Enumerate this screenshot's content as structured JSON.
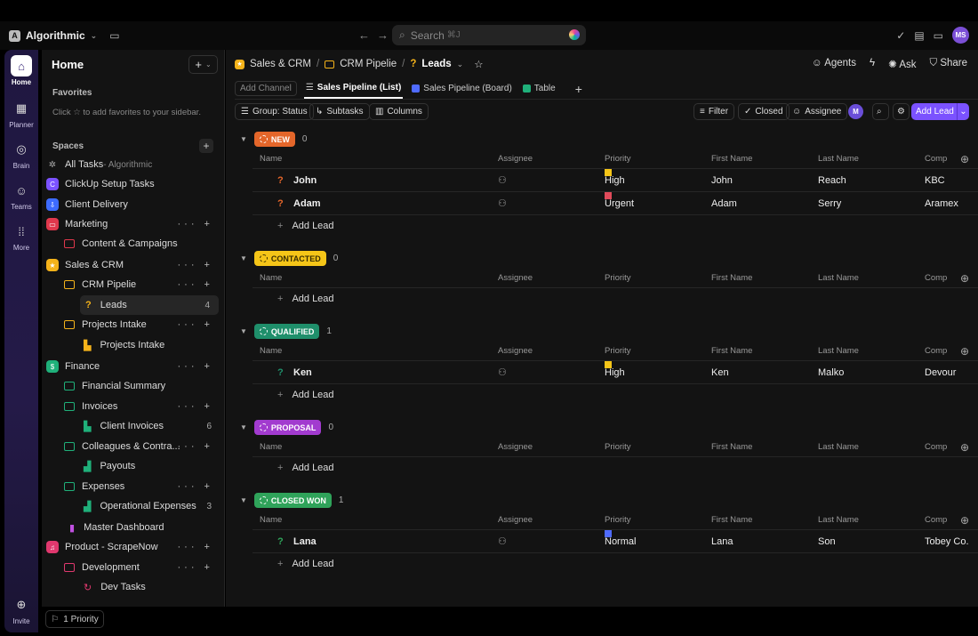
{
  "topbar": {
    "workspace_initial": "A",
    "workspace": "Algorithmic",
    "search_placeholder": "Search",
    "search_shortcut": "⌘J",
    "avatar": "MS"
  },
  "rail": [
    {
      "label": "Home",
      "icon": "home-icon",
      "glyph": "⌂"
    },
    {
      "label": "Planner",
      "icon": "calendar-icon",
      "glyph": "▦"
    },
    {
      "label": "Brain",
      "icon": "brain-icon",
      "glyph": "◎"
    },
    {
      "label": "Teams",
      "icon": "teams-icon",
      "glyph": "☺"
    },
    {
      "label": "More",
      "icon": "grid-icon",
      "glyph": "⁞⁞"
    },
    {
      "label": "Invite",
      "icon": "invite-icon",
      "glyph": "⊕"
    }
  ],
  "sidebar": {
    "title": "Home",
    "favorites_heading": "Favorites",
    "favorites_hint_pre": "Click",
    "favorites_hint_post": "to add favorites to your sidebar.",
    "spaces_heading": "Spaces",
    "items": [
      {
        "label": "All Tasks",
        "meta": " - Algorithmic"
      },
      {
        "label": "ClickUp Setup Tasks",
        "initial": "C"
      },
      {
        "label": "Client Delivery"
      },
      {
        "label": "Marketing"
      },
      {
        "label": "Content & Campaigns"
      },
      {
        "label": "Sales & CRM"
      },
      {
        "label": "CRM Pipelie"
      },
      {
        "label": "Leads",
        "count": "4"
      },
      {
        "label": "Projects Intake"
      },
      {
        "label": "Projects Intake"
      },
      {
        "label": "Finance"
      },
      {
        "label": "Financial Summary"
      },
      {
        "label": "Invoices"
      },
      {
        "label": "Client Invoices",
        "count": "6"
      },
      {
        "label": "Colleagues & Contra..."
      },
      {
        "label": "Payouts"
      },
      {
        "label": "Expenses"
      },
      {
        "label": "Operational Expenses",
        "count": "3"
      },
      {
        "label": "Master Dashboard"
      },
      {
        "label": "Product - ScrapeNow"
      },
      {
        "label": "Development"
      },
      {
        "label": "Dev Tasks"
      }
    ],
    "priority_label": "1 Priority"
  },
  "breadcrumb": {
    "space": "Sales & CRM",
    "folder": "CRM Pipelie",
    "list": "Leads"
  },
  "header_actions": {
    "agents": "Agents",
    "ask": "Ask",
    "share": "Share"
  },
  "tabs": {
    "add_channel": "Add Channel",
    "items": [
      "Sales Pipeline (List)",
      "Sales Pipeline (Board)",
      "Table"
    ]
  },
  "toolbar": {
    "group": "Group: Status",
    "subtasks": "Subtasks",
    "columns": "Columns",
    "filter": "Filter",
    "closed": "Closed",
    "assignee": "Assignee",
    "me": "M",
    "add_lead": "Add Lead"
  },
  "columns": [
    "Name",
    "Assignee",
    "Priority",
    "First Name",
    "Last Name",
    "Comp"
  ],
  "add_row_label": "Add Lead",
  "groups": [
    {
      "status": "NEW",
      "count": "0",
      "color": "#e4662a",
      "rows": [
        {
          "name": "John",
          "priority": "High",
          "first": "John",
          "last": "Reach",
          "company": "KBC"
        },
        {
          "name": "Adam",
          "priority": "Urgent",
          "first": "Adam",
          "last": "Serry",
          "company": "Aramex"
        }
      ]
    },
    {
      "status": "CONTACTED",
      "count": "0",
      "color": "#f5c518",
      "rows": []
    },
    {
      "status": "QUALIFIED",
      "count": "1",
      "color": "#1f8f6b",
      "rows": [
        {
          "name": "Ken",
          "priority": "High",
          "first": "Ken",
          "last": "Malko",
          "company": "Devour"
        }
      ]
    },
    {
      "status": "PROPOSAL",
      "count": "0",
      "color": "#a23bcf",
      "rows": []
    },
    {
      "status": "CLOSED WON",
      "count": "1",
      "color": "#2fa35a",
      "rows": [
        {
          "name": "Lana",
          "priority": "Normal",
          "first": "Lana",
          "last": "Son",
          "company": "Tobey Co."
        }
      ]
    }
  ]
}
